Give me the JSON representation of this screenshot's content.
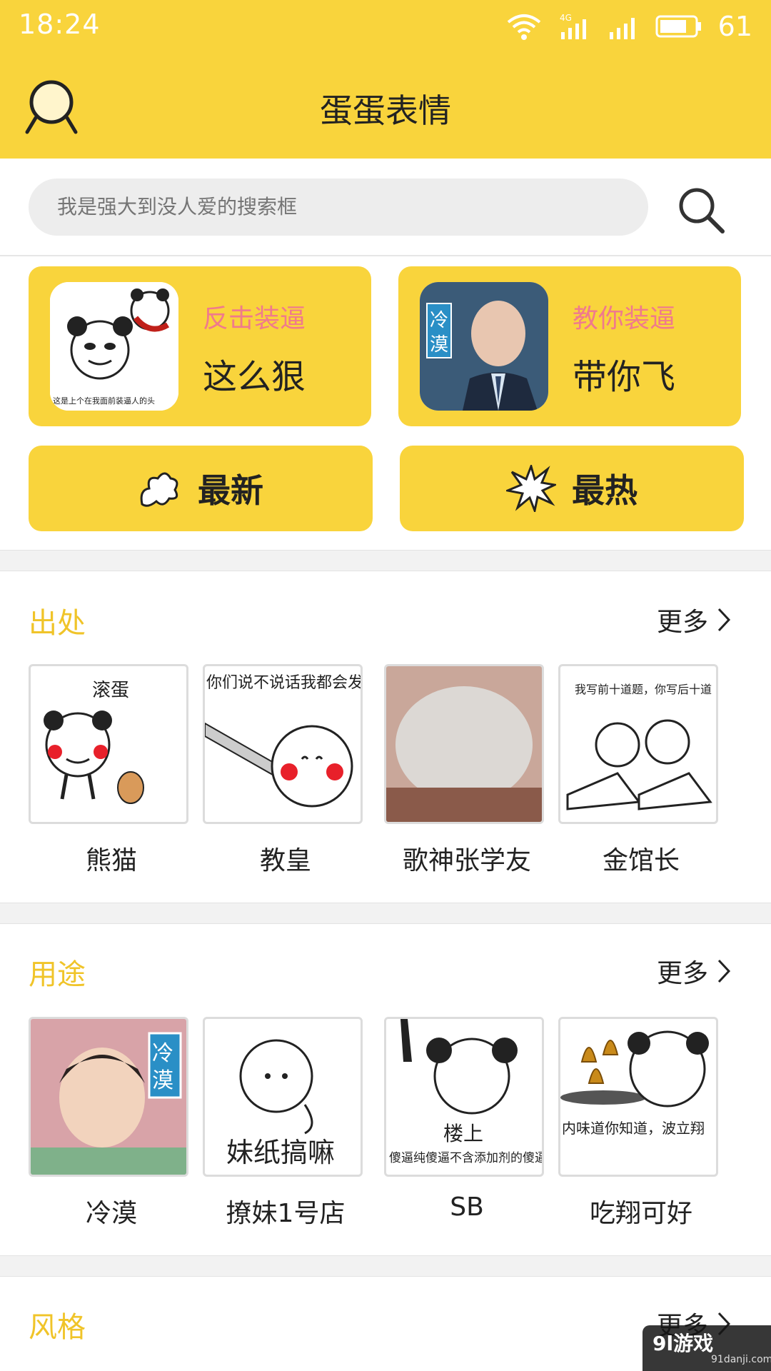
{
  "status_bar": {
    "time": "18:24",
    "network": "4G",
    "battery": "61"
  },
  "app_bar": {
    "title": "蛋蛋表情",
    "profile_icon": "user-icon"
  },
  "search": {
    "placeholder": "我是强大到没人爱的搜索框",
    "icon": "search-icon"
  },
  "feature_cards": [
    {
      "tag": "反击装逼",
      "text": "这么狠",
      "image_caption": "这是上个在我面前装逼人的头"
    },
    {
      "tag": "教你装逼",
      "text": "带你飞",
      "image_caption": "冷漠"
    }
  ],
  "quick_buttons": [
    {
      "label": "最新",
      "icon": "splat-icon"
    },
    {
      "label": "最热",
      "icon": "burst-icon"
    }
  ],
  "sections": [
    {
      "title": "出处",
      "more": "更多",
      "items": [
        {
          "label": "熊猫",
          "caption": "滚蛋"
        },
        {
          "label": "教皇",
          "caption": "你们说不说话我都会发大招"
        },
        {
          "label": "歌神张学友",
          "caption": ""
        },
        {
          "label": "金馆长",
          "caption": "我写前十道题，你写后十道"
        }
      ]
    },
    {
      "title": "用途",
      "more": "更多",
      "items": [
        {
          "label": "冷漠",
          "caption": "冷漠"
        },
        {
          "label": "撩妹1号店",
          "caption": "妹纸搞嘛"
        },
        {
          "label": "SB",
          "caption": "楼上",
          "caption2": "傻逼纯傻逼不含添加剂的傻逼！"
        },
        {
          "label": "吃翔可好",
          "caption": "内味道你知道，波立翔"
        }
      ]
    },
    {
      "title": "风格",
      "more": "更多"
    }
  ],
  "watermark": {
    "main": "9l游戏",
    "sub": "91danji.com"
  },
  "colors": {
    "brand_yellow": "#f9d43c",
    "tag_pink": "#f07a8c",
    "section_title": "#f0c429"
  }
}
